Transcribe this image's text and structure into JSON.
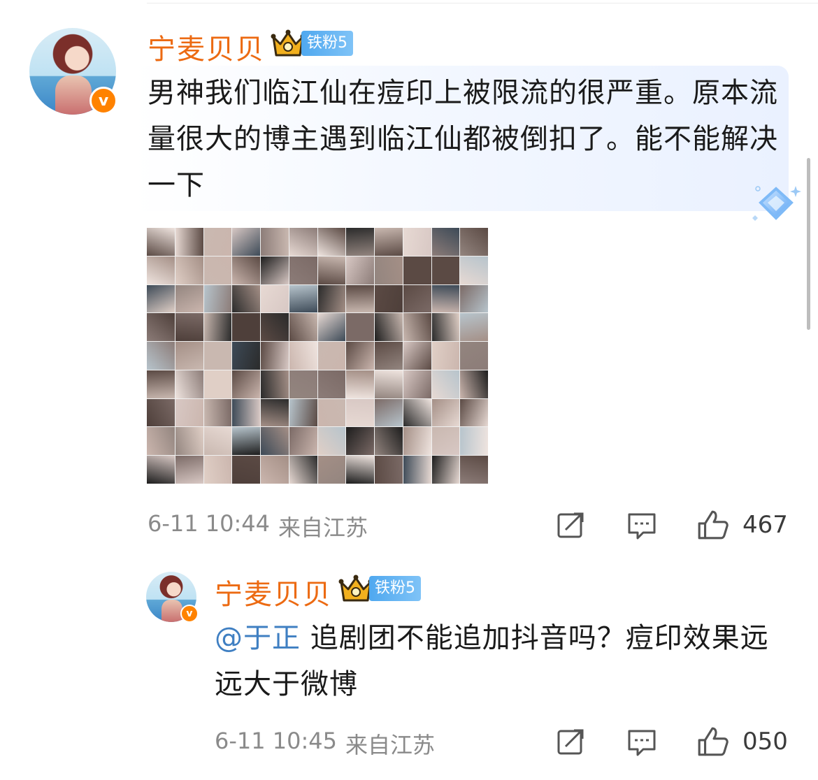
{
  "comment": {
    "username": "宁麦贝贝",
    "fan_badge": "铁粉5",
    "verified_badge": "v",
    "text": "男神我们临江仙在痘印上被限流的很严重。原本流量很大的博主遇到临江仙都被倒扣了。能不能解决一下",
    "time": "6-11 10:44",
    "location": "来自江苏",
    "like_count": "467"
  },
  "reply": {
    "username": "宁麦贝贝",
    "fan_badge": "铁粉5",
    "verified_badge": "v",
    "mention": "@于正",
    "text": " 追剧团不能追加抖音吗？痘印效果远远大于微博",
    "time": "6-11 10:45",
    "location": "来自江苏",
    "like_count": "050"
  },
  "colors": {
    "username": "#ec6a12",
    "mention": "#3f7fc2",
    "meta": "#8a8a8a",
    "fan_badge": "#4fa8ef",
    "verified": "#ff8200"
  },
  "icons": [
    "repost-icon",
    "comment-icon",
    "like-icon",
    "crown-icon",
    "diamond-icon"
  ]
}
